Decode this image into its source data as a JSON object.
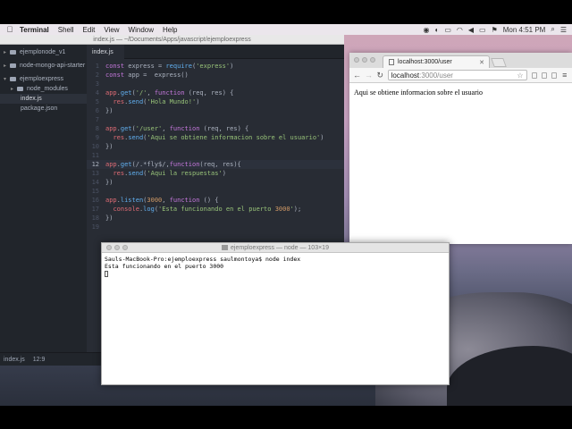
{
  "menubar": {
    "app": "Terminal",
    "items": [
      "Shell",
      "Edit",
      "View",
      "Window",
      "Help"
    ],
    "clock": "Mon 4:51 PM"
  },
  "editor": {
    "title": "index.js — ~/Documents/Apps/javascript/ejemploexpress",
    "tab": "index.js",
    "tree": [
      {
        "label": "ejemplonode_v1",
        "type": "folder",
        "expanded": false,
        "indent": 0
      },
      {
        "label": "node-mongo-api-starter",
        "type": "folder",
        "expanded": false,
        "indent": 0
      },
      {
        "label": "ejemploexpress",
        "type": "folder",
        "expanded": true,
        "indent": 0
      },
      {
        "label": "node_modules",
        "type": "folder",
        "expanded": false,
        "indent": 1
      },
      {
        "label": "index.js",
        "type": "file",
        "selected": true,
        "indent": 1
      },
      {
        "label": "package.json",
        "type": "file",
        "indent": 1
      }
    ],
    "lines": [
      {
        "n": "1",
        "text": "const express = require('express')"
      },
      {
        "n": "2",
        "text": "const app =  express()"
      },
      {
        "n": "3",
        "text": ""
      },
      {
        "n": "4",
        "text": "app.get('/', function (req, res) {"
      },
      {
        "n": "5",
        "text": "  res.send('Hola Mundo!')"
      },
      {
        "n": "6",
        "text": "})"
      },
      {
        "n": "7",
        "text": ""
      },
      {
        "n": "8",
        "text": "app.get('/user', function (req, res) {"
      },
      {
        "n": "9",
        "text": "  res.send('Aqui se obtiene informacion sobre el usuario')"
      },
      {
        "n": "10",
        "text": "})"
      },
      {
        "n": "11",
        "text": ""
      },
      {
        "n": "12",
        "text": "app.get(/.*fly$/,function(req, res){"
      },
      {
        "n": "13",
        "text": "  res.send('Aqui la respuestas')"
      },
      {
        "n": "14",
        "text": "})"
      },
      {
        "n": "15",
        "text": ""
      },
      {
        "n": "16",
        "text": "app.listen(3000, function () {"
      },
      {
        "n": "17",
        "text": "  console.log('Esta funcionando en el puerto 3000');"
      },
      {
        "n": "18",
        "text": "})"
      },
      {
        "n": "19",
        "text": ""
      }
    ],
    "active_line": "12",
    "status": {
      "file": "index.js",
      "position": "12:9"
    }
  },
  "browser": {
    "tab_title": "localhost:3000/user",
    "url_host": "localhost",
    "url_path": ":3000/user",
    "content": "Aqui se obtiene informacion sobre el usuario"
  },
  "terminal": {
    "title": "ejemploexpress — node — 103×19",
    "lines": [
      "Sauls-MacBook-Pro:ejemploexpress saulmontoya$ node index",
      "Esta funcionando en el puerto 3000"
    ]
  }
}
